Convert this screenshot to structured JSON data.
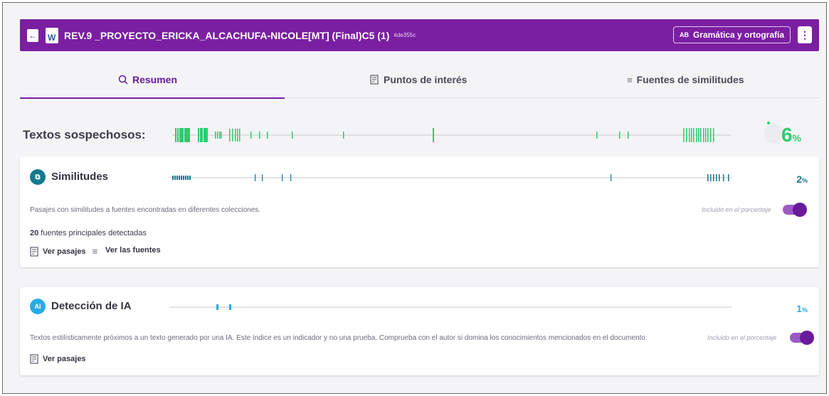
{
  "header": {
    "back_icon": "arrow-left-icon",
    "file_icon": "word-icon",
    "file_icon_letter": "W",
    "title": "REV.9 _PROYECTO_ERICKA_ALCACHUFA-NICOLE[MT] (Final)C5 (1)",
    "hash": "#de355c",
    "grammar_icon_text": "AB",
    "grammar_label": "Gramática y ortografía",
    "menu_icon": "⋮",
    "color": "#7b1fa2"
  },
  "tabs": [
    {
      "icon": "magnifier-icon",
      "label": "Resumen",
      "active": true
    },
    {
      "icon": "document-search-icon",
      "label": "Puntos de interés",
      "active": false
    },
    {
      "icon": "list-icon",
      "label": "Fuentes de similitudes",
      "active": false
    }
  ],
  "suspicious": {
    "label": "Textos sospechosos:",
    "percent_value": "6",
    "percent_sign": "%",
    "color": "#2ecc71"
  },
  "similarities": {
    "title": "Similitudes",
    "percent_value": "2",
    "percent_sign": "%",
    "color": "#157a8c",
    "description": "Pasajes con similitudes a fuentes encontradas en diferentes colecciones.",
    "included_label": "Incluido en el porcentaje",
    "toggle_on": true,
    "sources_count": "20",
    "sources_text": " fuentes principales detectadas",
    "view_passages": "Ver pasajes",
    "view_sources": "Ver las fuentes"
  },
  "ai_detection": {
    "title": "Detección de IA",
    "icon_text": "AI",
    "percent_value": "1",
    "percent_sign": "%",
    "color": "#29abe2",
    "description": "Textos estilísticamente próximos a un texto generado por una IA. Este índice es un indicador y no una prueba. Comprueba con el autor si domina los conocimientos mencionados en el documento.",
    "included_label": "Incluido en el porcentaje",
    "toggle_on": true,
    "view_passages": "Ver pasajes"
  }
}
